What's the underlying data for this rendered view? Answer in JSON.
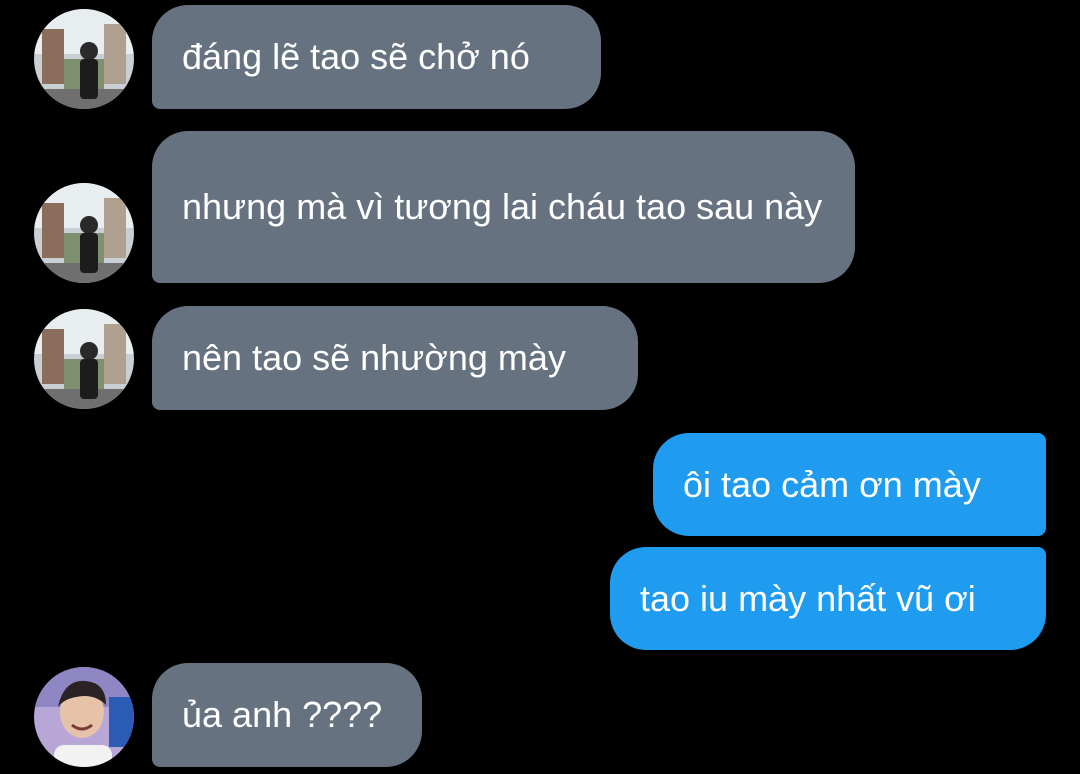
{
  "messages": [
    {
      "direction": "incoming",
      "text": "đáng lẽ tao sẽ chở nó",
      "avatar": "street-photo"
    },
    {
      "direction": "incoming",
      "text": "nhưng mà vì tương lai cháu tao sau này",
      "avatar": "street-photo"
    },
    {
      "direction": "incoming",
      "text": "nên tao sẽ nhường mày",
      "avatar": "street-photo"
    },
    {
      "direction": "outgoing",
      "text": "ôi tao cảm ơn mày"
    },
    {
      "direction": "outgoing",
      "text": "tao iu mày nhất vũ ơi"
    },
    {
      "direction": "incoming",
      "text": "ủa anh ????",
      "avatar": "smiling-portrait"
    }
  ],
  "colors": {
    "background": "#000000",
    "incoming_bubble": "#66727f",
    "outgoing_bubble": "#1f9cf0",
    "text": "#ffffff"
  }
}
